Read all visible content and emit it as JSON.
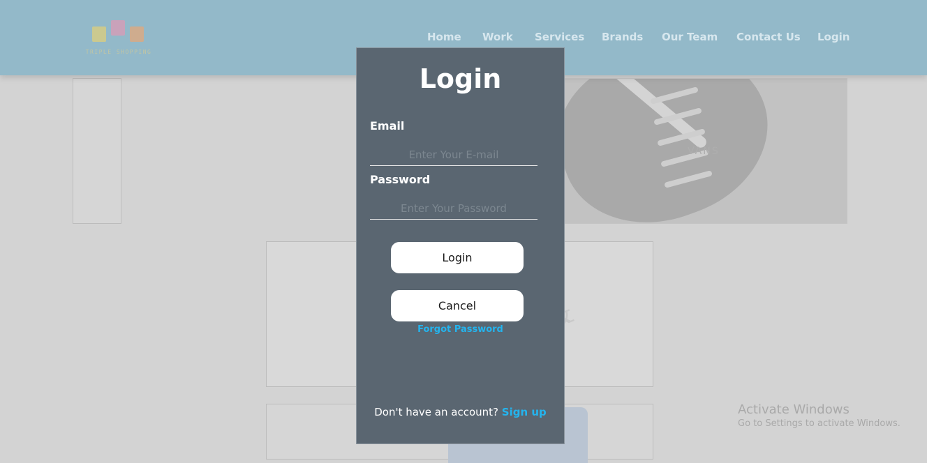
{
  "header": {
    "logo_text": "TRIPLE SHOPPING",
    "nav": [
      {
        "label": "Home"
      },
      {
        "label": "Work"
      },
      {
        "label": "Services"
      },
      {
        "label": "Brands"
      },
      {
        "label": "Our Team"
      },
      {
        "label": "Contact Us"
      },
      {
        "label": "Login"
      }
    ]
  },
  "background": {
    "shoe_brand": "VANS",
    "tiffany_watermark": "TIFFANY & CO."
  },
  "modal": {
    "title": "Login",
    "email_label": "Email",
    "email_placeholder": "Enter Your E-mail",
    "email_value": "",
    "password_label": "Password",
    "password_placeholder": "Enter Your Password",
    "password_value": "",
    "login_button": "Login",
    "cancel_button": "Cancel",
    "forgot_link": "Forgot Password",
    "signup_prompt": "Don't have an account?",
    "signup_link": "Sign up"
  },
  "os_watermark": {
    "line1": "Activate Windows",
    "line2": "Go to Settings to activate Windows."
  },
  "colors": {
    "header_bg": "#93b9c9",
    "modal_bg": "#5a6671",
    "link": "#24b4ee",
    "button_bg": "#ffffff"
  }
}
